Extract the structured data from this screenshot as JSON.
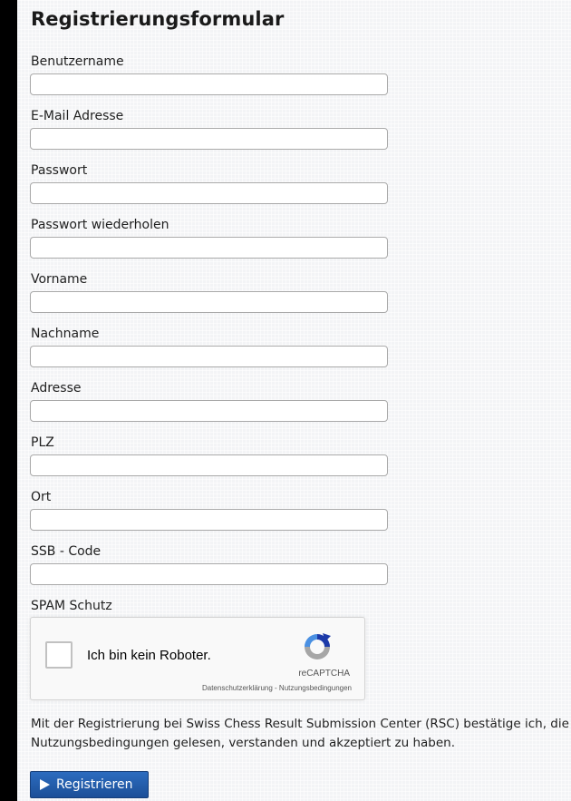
{
  "form": {
    "title": "Registrierungsformular",
    "fields": [
      {
        "label": "Benutzername",
        "value": ""
      },
      {
        "label": "E-Mail Adresse",
        "value": ""
      },
      {
        "label": "Passwort",
        "value": ""
      },
      {
        "label": "Passwort wiederholen",
        "value": ""
      },
      {
        "label": "Vorname",
        "value": ""
      },
      {
        "label": "Nachname",
        "value": ""
      },
      {
        "label": "Adresse",
        "value": ""
      },
      {
        "label": "PLZ",
        "value": ""
      },
      {
        "label": "Ort",
        "value": ""
      },
      {
        "label": "SSB - Code",
        "value": ""
      }
    ],
    "spam_label": "SPAM Schutz",
    "captcha": {
      "checkbox_label": "Ich bin kein Roboter.",
      "brand": "reCAPTCHA",
      "privacy_link": "Datenschutzerklärung",
      "separator": " - ",
      "terms_link": "Nutzungsbedingungen",
      "checked": false
    },
    "notice": "Mit der Registrierung bei Swiss Chess Result Submission Center (RSC) bestätige ich, die Nutzungsbedingungen gelesen, verstanden und akzeptiert zu haben.",
    "submit_label": "Registrieren"
  },
  "colors": {
    "page_background": "#f3f4f6",
    "button": "#1c4f98",
    "captcha_blue": "#1c3aa9",
    "captcha_grey": "#a6a6a6"
  },
  "icons": {
    "submit": "play-icon",
    "captcha": "recaptcha-logo-icon"
  }
}
